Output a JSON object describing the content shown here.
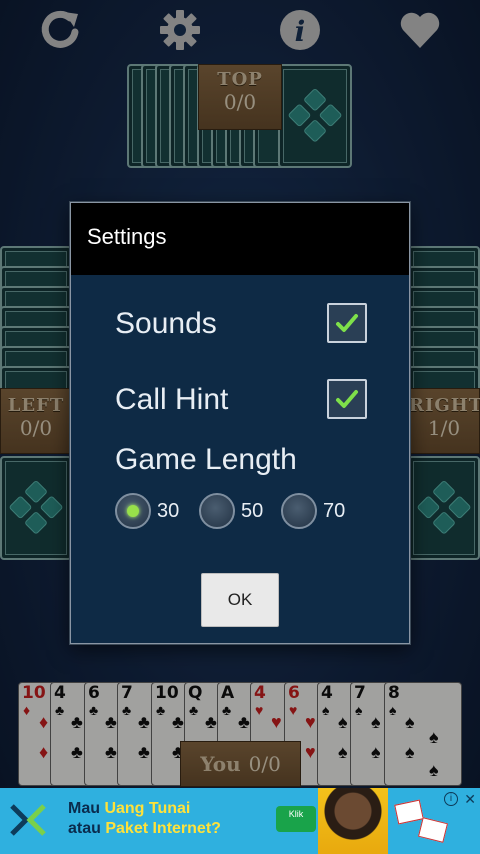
{
  "toolbar": {
    "restart_icon": "restart-icon",
    "settings_icon": "gear-icon",
    "info_icon": "info-icon",
    "favorite_icon": "heart-icon"
  },
  "players": {
    "top": {
      "name": "TOP",
      "score": "0/0"
    },
    "left": {
      "name": "LEFT",
      "score": "0/0"
    },
    "right": {
      "name": "RIGHT",
      "score": "1/0"
    },
    "you": {
      "name": "You",
      "score": "0/0"
    }
  },
  "dialog": {
    "title": "Settings",
    "sounds_label": "Sounds",
    "sounds_checked": true,
    "call_hint_label": "Call Hint",
    "call_hint_checked": true,
    "game_length_label": "Game Length",
    "game_length_options": [
      "30",
      "50",
      "70"
    ],
    "game_length_selected": "30",
    "ok_label": "OK"
  },
  "hand": [
    {
      "rank": "10",
      "suit": "♦",
      "color": "red"
    },
    {
      "rank": "4",
      "suit": "♣",
      "color": "black"
    },
    {
      "rank": "6",
      "suit": "♣",
      "color": "black"
    },
    {
      "rank": "7",
      "suit": "♣",
      "color": "black"
    },
    {
      "rank": "10",
      "suit": "♣",
      "color": "black"
    },
    {
      "rank": "Q",
      "suit": "♣",
      "color": "black"
    },
    {
      "rank": "A",
      "suit": "♣",
      "color": "black"
    },
    {
      "rank": "4",
      "suit": "♥",
      "color": "red"
    },
    {
      "rank": "6",
      "suit": "♥",
      "color": "red"
    },
    {
      "rank": "4",
      "suit": "♠",
      "color": "black"
    },
    {
      "rank": "7",
      "suit": "♠",
      "color": "black"
    },
    {
      "rank": "8",
      "suit": "♠",
      "color": "black"
    }
  ],
  "ad": {
    "line1_plain": "Mau ",
    "line1_highlight": "Uang Tunai",
    "line2_plain": "atau ",
    "line2_highlight": "Paket Internet",
    "line2_end": "?",
    "cta": "Klik",
    "info_icon": "info-icon",
    "close_icon": "close-icon",
    "brand_color": "#2fb0df",
    "highlight_color": "#ffe23a"
  }
}
